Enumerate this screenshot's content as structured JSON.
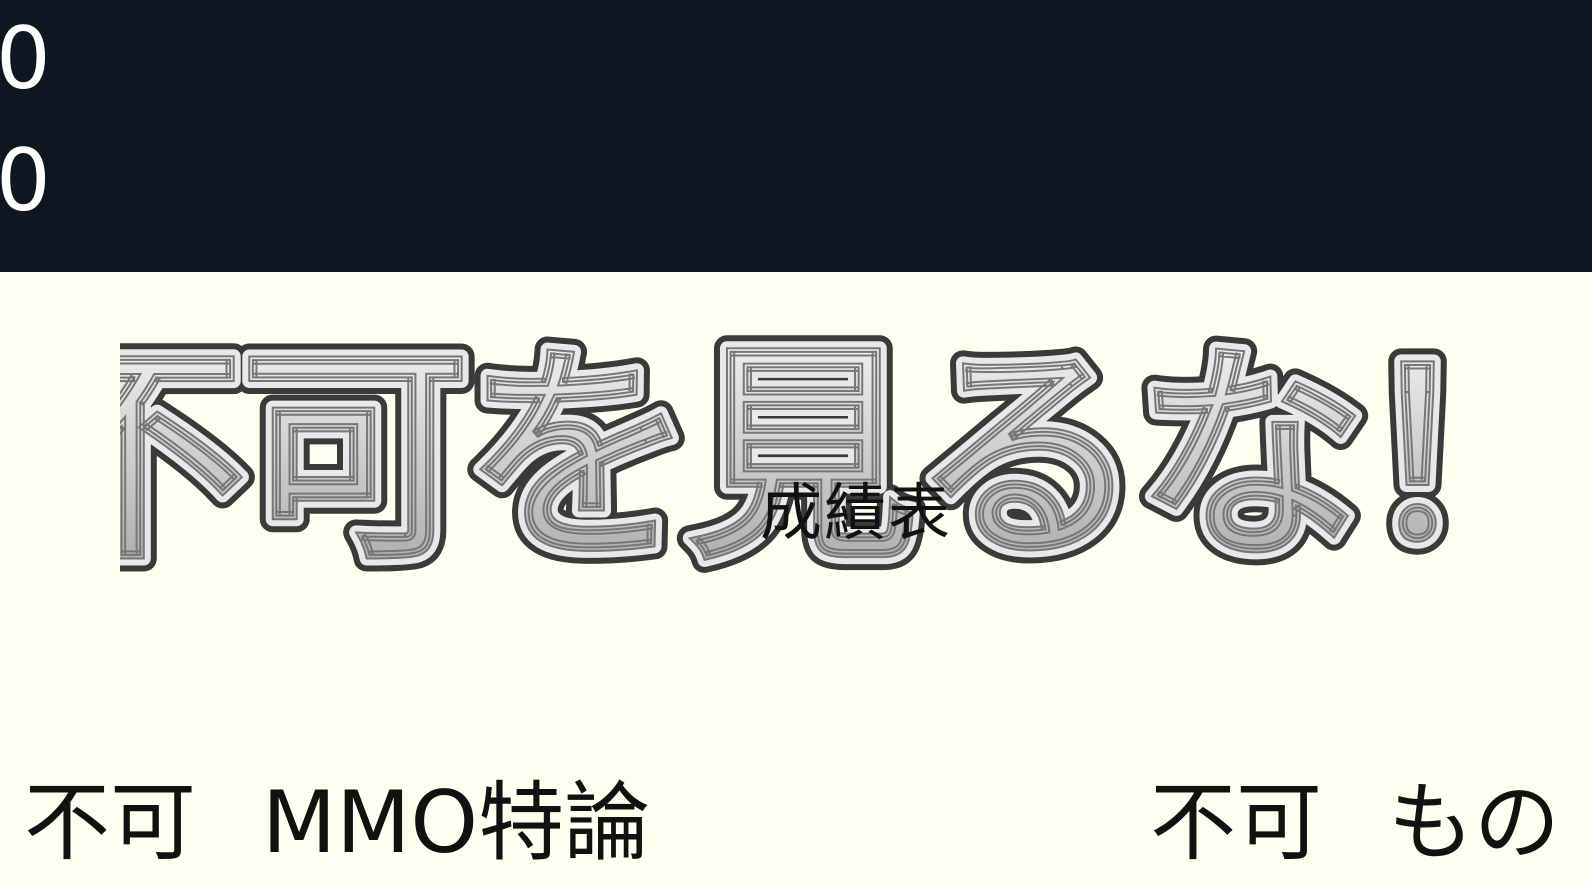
{
  "hud": {
    "counter_1": "0",
    "counter_2": "0"
  },
  "logo": {
    "text": "不可を見るな！"
  },
  "report": {
    "title": "成績表"
  },
  "grades": [
    {
      "grade": "不可",
      "course": "MMO特論"
    },
    {
      "grade": "不可",
      "course": "もの"
    }
  ],
  "colors": {
    "top_bg": "#0d1621",
    "paper_bg": "#fffff0",
    "logo_fill_top": "#f2f2f2",
    "logo_fill_bottom": "#a8a8a8",
    "logo_outline": "#3a3a3a"
  }
}
